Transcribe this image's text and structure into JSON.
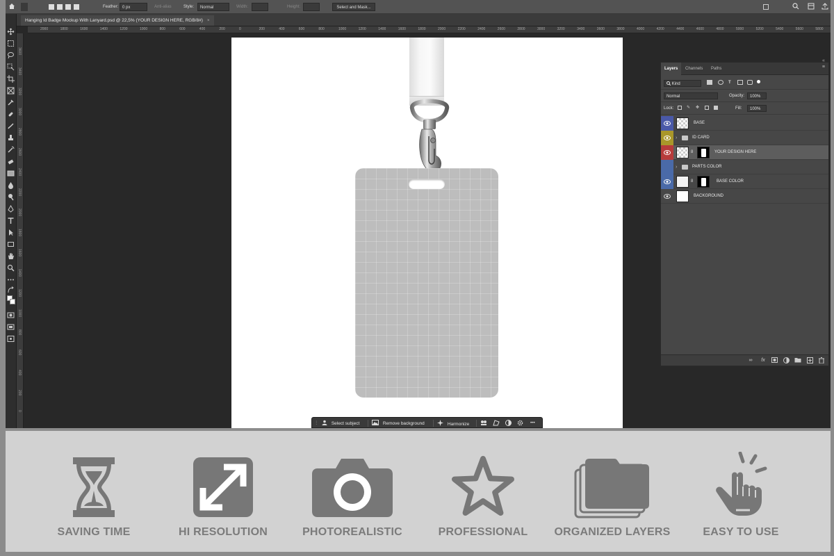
{
  "app": {
    "document_tab": "Hanging Id Badge Mockup With Lanyard.psd @ 22,5% (YOUR DESIGN HERE, RGB/8#)",
    "close_glyph": "×"
  },
  "options_bar": {
    "feather_label": "Feather:",
    "feather_value": "0 px",
    "antialias_label": "Anti-alias",
    "style_label": "Style:",
    "style_value": "Normal",
    "width_label": "Width:",
    "height_label": "Height:",
    "select_mask_label": "Select and Mask..."
  },
  "ruler": {
    "labels": [
      "2000",
      "1800",
      "1600",
      "1400",
      "1200",
      "1000",
      "800",
      "600",
      "400",
      "200",
      "0",
      "200",
      "400",
      "600",
      "800",
      "1000",
      "1200",
      "1400",
      "1600",
      "1800",
      "2000",
      "2200",
      "2400",
      "2600",
      "2800",
      "3000",
      "3200",
      "3400",
      "3600",
      "3800",
      "4000",
      "4200",
      "4400",
      "4600",
      "4800",
      "5000",
      "5200",
      "5400",
      "5600",
      "5800"
    ]
  },
  "vruler": {
    "labels": [
      "3600",
      "3400",
      "3200",
      "3000",
      "2800",
      "2600",
      "2400",
      "2200",
      "2000",
      "1800",
      "1600",
      "1400",
      "1200",
      "1000",
      "800",
      "600",
      "400",
      "200",
      "0"
    ]
  },
  "taskbar": {
    "select_subject": "Select subject",
    "remove_background": "Remove background",
    "harmonize": "Harmonize",
    "more": "•••"
  },
  "layers_panel": {
    "tabs": [
      "Layers",
      "Channels",
      "Paths"
    ],
    "filter_kind": "Kind",
    "blend_mode": "Normal",
    "opacity_label": "Opacity:",
    "opacity_value": "100%",
    "lock_label": "Lock:",
    "fill_label": "Fill:",
    "fill_value": "100%",
    "layers": [
      {
        "name": "BASE",
        "eye_color": "#4a59a8",
        "type": "layer"
      },
      {
        "name": "ID CARD",
        "eye_color": "#a9972a",
        "type": "group"
      },
      {
        "name": "YOUR DESIGN HERE",
        "eye_color": "#b73b3b",
        "type": "smart",
        "selected": true
      },
      {
        "name": "PARTS COLOR",
        "eye_color": "#4a6aa8",
        "type": "group",
        "hidden": true
      },
      {
        "name": "BASE COLOR",
        "eye_color": "#4a6aa8",
        "type": "masked"
      },
      {
        "name": "BACKGROUND",
        "eye_color": "#474747",
        "type": "background"
      }
    ]
  },
  "features": [
    {
      "label": "SAVING TIME",
      "icon": "hourglass-icon"
    },
    {
      "label": "HI RESOLUTION",
      "icon": "expand-arrows-icon"
    },
    {
      "label": "PHOTOREALISTIC",
      "icon": "camera-icon"
    },
    {
      "label": "PROFESSIONAL",
      "icon": "star-icon"
    },
    {
      "label": "ORGANIZED LAYERS",
      "icon": "stacked-layers-icon"
    },
    {
      "label": "EASY TO USE",
      "icon": "tap-hand-icon"
    }
  ],
  "colors": {
    "feature_icon": "#777777",
    "feature_bg": "#d2d2d2",
    "ps_bg": "#282828",
    "panel_bg": "#474747"
  }
}
